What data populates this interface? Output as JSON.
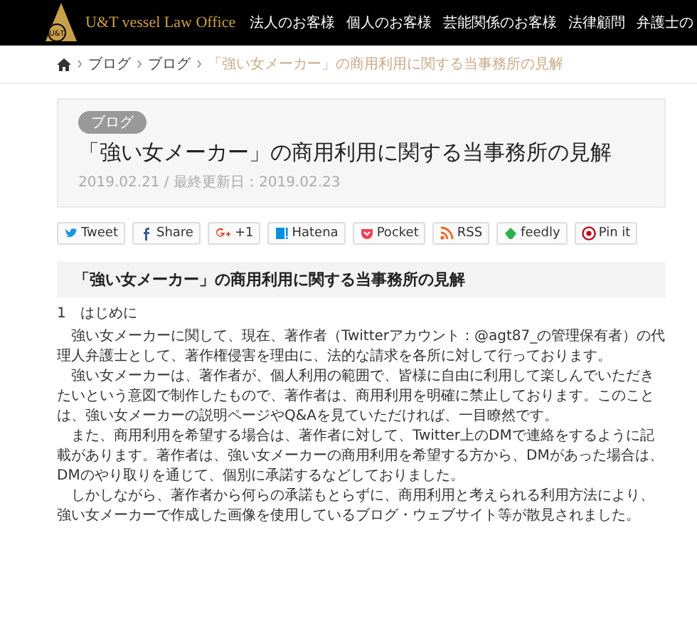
{
  "header": {
    "logo_text": "U&T vessel Law Office",
    "logo_mark": "U&T",
    "nav": [
      "法人のお客様",
      "個人のお客様",
      "芸能関係のお客様",
      "法律顧問",
      "弁護士の"
    ]
  },
  "breadcrumb": {
    "items": [
      "ブログ",
      "ブログ"
    ],
    "current": "「強い女メーカー」の商用利用に関する当事務所の見解"
  },
  "hero": {
    "category": "ブログ",
    "title": "「強い女メーカー」の商用利用に関する当事務所の見解",
    "date": "2019.02.21 / 最終更新日：2019.02.23"
  },
  "share_buttons": [
    {
      "kind": "twitter",
      "label": "Tweet"
    },
    {
      "kind": "facebook",
      "label": "Share"
    },
    {
      "kind": "google",
      "label": "+1"
    },
    {
      "kind": "hatena",
      "label": "Hatena"
    },
    {
      "kind": "pocket",
      "label": "Pocket"
    },
    {
      "kind": "rss",
      "label": "RSS"
    },
    {
      "kind": "feedly",
      "label": "feedly"
    },
    {
      "kind": "pinterest",
      "label": "Pin it"
    }
  ],
  "article": {
    "heading": "「強い女メーカー」の商用利用に関する当事務所の見解",
    "section": "1　はじめに",
    "paragraphs": [
      "強い女メーカーに関して、現在、著作者（Twitterアカウント：@agt87_の管理保有者）の代理人弁護士として、著作権侵害を理由に、法的な請求を各所に対して行っております。",
      "強い女メーカーは、著作者が、個人利用の範囲で、皆様に自由に利用して楽しんでいただきたいという意図で制作したもので、著作者は、商用利用を明確に禁止しております。このことは、強い女メーカーの説明ページやQ&Aを見ていただければ、一目瞭然です。",
      "また、商用利用を希望する場合は、著作者に対して、Twitter上のDMで連絡をするように記載があります。著作者は、強い女メーカーの商用利用を希望する方から、DMがあった場合は、DMのやり取りを通じて、個別に承諾するなどしておりました。",
      "しかしながら、著作者から何らの承諾もとらずに、商用利用と考えられる利用方法により、強い女メーカーで作成した画像を使用しているブログ・ウェブサイト等が散見されました。"
    ]
  }
}
